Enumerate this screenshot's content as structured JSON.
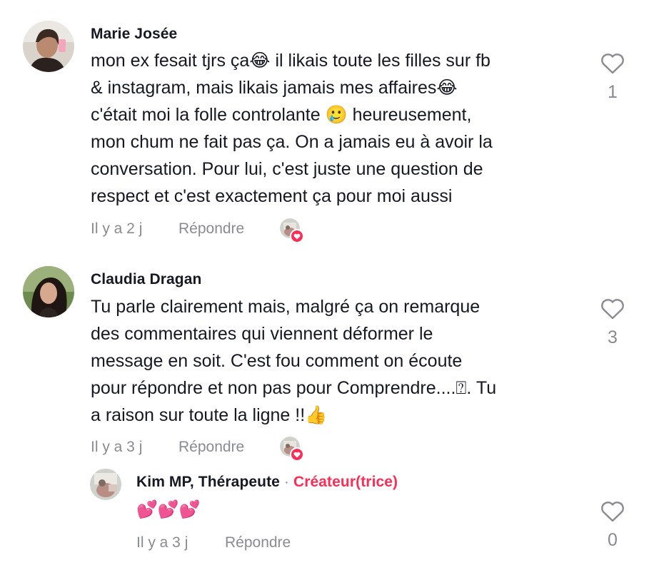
{
  "comments": [
    {
      "author": "Marie Josée",
      "lines": [
        "mon ex fesait tjrs ça😂 il likais toute les filles sur fb",
        "& instagram, mais likais jamais mes affaires😂",
        "c'était moi la folle controlante 🥲 heureusement,",
        "mon chum ne fait pas ça. On a jamais eu à avoir la",
        "conversation. Pour lui, c'est juste une question de",
        "respect et c'est exactement ça pour moi aussi"
      ],
      "time": "Il y a 2 j",
      "reply_label": "Répondre",
      "like_count": "1"
    },
    {
      "author": "Claudia Dragan",
      "lines": [
        "Tu parle clairement mais, malgré ça on remarque",
        "des commentaires qui viennent déformer le",
        "message en soit. C'est fou comment on écoute",
        "pour répondre et non pas pour Comprendre....⍰. Tu",
        "a raison sur toute la ligne !!👍"
      ],
      "time": "Il y a 3 j",
      "reply_label": "Répondre",
      "like_count": "3"
    }
  ],
  "reply": {
    "author": "Kim MP, Thérapeute",
    "separator": "·",
    "creator_badge": "Créateur(trice)",
    "text": "💕💕💕",
    "time": "Il y a 3 j",
    "reply_label": "Répondre",
    "like_count": "0"
  },
  "colors": {
    "text": "#161823",
    "muted": "#8a8b91",
    "accent": "#fe2c55"
  }
}
